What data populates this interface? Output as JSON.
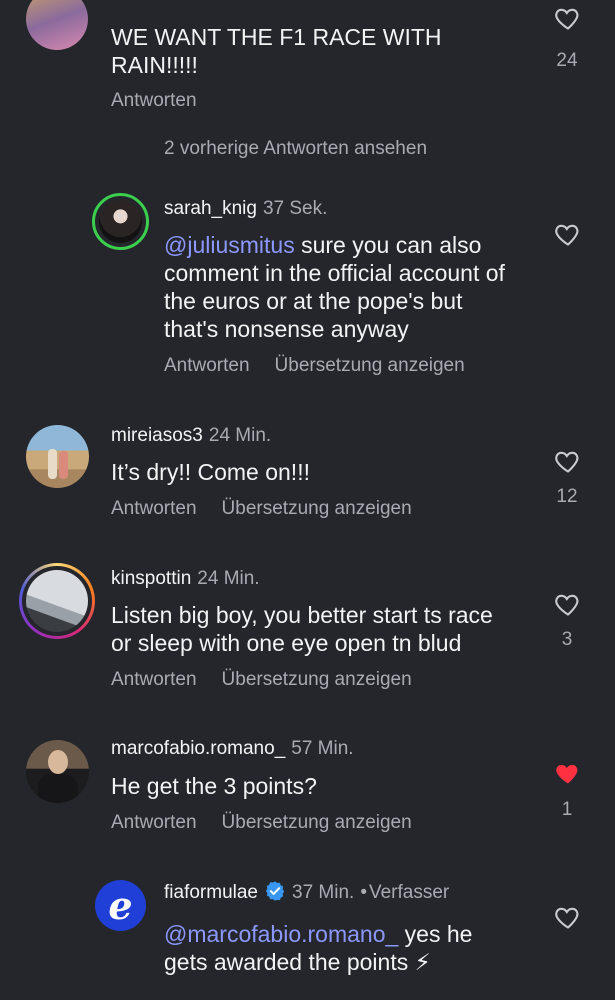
{
  "comments": [
    {
      "id": "c0",
      "text": "WE WANT THE F1 RACE WITH RAIN!!!!!",
      "reply_label": "Antworten",
      "likes": "24"
    },
    {
      "id": "more",
      "label": "2 vorherige Antworten ansehen"
    },
    {
      "id": "c1",
      "username": "sarah_knig",
      "time": "37 Sek.",
      "mention": "@juliusmitus",
      "text": " sure you can also comment in the official account of the euros or at the pope's but that's nonsense anyway",
      "reply_label": "Antworten",
      "translate_label": "Übersetzung anzeigen"
    },
    {
      "id": "c2",
      "username": "mireiasos3",
      "time": "24 Min.",
      "text": "It’s dry!! Come on!!!",
      "reply_label": "Antworten",
      "translate_label": "Übersetzung anzeigen",
      "likes": "12"
    },
    {
      "id": "c3",
      "username": "kinspottin",
      "time": "24 Min.",
      "text": "Listen big boy, you better start ts race or sleep with one eye open tn blud",
      "reply_label": "Antworten",
      "translate_label": "Übersetzung anzeigen",
      "likes": "3"
    },
    {
      "id": "c4",
      "username": "marcofabio.romano_",
      "time": "57 Min.",
      "text": "He get the 3 points?",
      "reply_label": "Antworten",
      "translate_label": "Übersetzung anzeigen",
      "likes": "1",
      "liked": true
    },
    {
      "id": "c5",
      "username": "fiaformulae",
      "time": "37 Min.",
      "separator": "•",
      "author_label": "Verfasser",
      "mention": "@marcofabio.romano_",
      "text": " yes he gets awarded the points ⚡"
    }
  ],
  "icons": {
    "heart": "heart-outline-icon",
    "heart_filled": "heart-filled-icon",
    "verified": "verified-badge-icon"
  },
  "colors": {
    "background": "#24262b",
    "mention": "#8c98ff",
    "liked": "#ff3040",
    "story_ring_green": "#3ccf4e",
    "verified": "#3897f0"
  }
}
